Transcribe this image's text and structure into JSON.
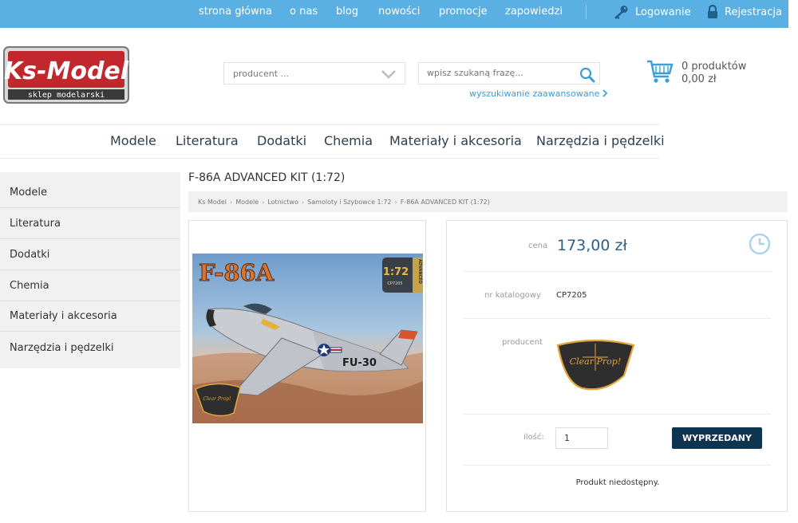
{
  "top_nav": {
    "items": [
      "strona główna",
      "o nas",
      "blog",
      "nowości",
      "promocje",
      "zapowiedzi"
    ],
    "login": "Logowanie",
    "register": "Rejestracja"
  },
  "logo": {
    "name": "Ks-Model",
    "tagline": "sklep modelarski"
  },
  "search": {
    "producer_placeholder": "producent ...",
    "query_placeholder": "wpisz szukaną frazę...",
    "advanced_link": "wyszukiwanie zaawansowane"
  },
  "cart": {
    "count": "0 produktów",
    "total": "0,00 zł"
  },
  "main_nav": [
    "Modele",
    "Literatura",
    "Dodatki",
    "Chemia",
    "Materiały i akcesoria",
    "Narzędzia i pędzelki"
  ],
  "sidebar": [
    "Modele",
    "Literatura",
    "Dodatki",
    "Chemia",
    "Materiały i akcesoria",
    "Narzędzia i pędzelki"
  ],
  "product": {
    "title": "F-86A ADVANCED KIT (1:72)",
    "breadcrumb": [
      "Ks Model",
      "Modele",
      "Lotnictwo",
      "Samoloty i Szybowce 1:72",
      "F-86A ADVANCED KIT (1:72)"
    ],
    "box_art": {
      "name": "F-86A",
      "scale": "1:72",
      "catalog": "CP7205",
      "tail_code": "FU-30",
      "series": "ADVANCED",
      "maker_logo": "Clear Prop!"
    },
    "price_label": "cena",
    "price": "173,00 zł",
    "catalog_label": "nr katalogowy",
    "catalog_number": "CP7205",
    "producer_label": "producent",
    "producer_logo_text": "Clear Prop!",
    "quantity_label": "ilość:",
    "quantity": "1",
    "soldout_button": "WYPRZEDANY",
    "availability": "Produkt niedostępny."
  },
  "colors": {
    "top_bar": "#5ab0e2",
    "link": "#3b9ed6",
    "price": "#2d5f87",
    "button": "#0f3450",
    "logo_red": "#c1272d"
  }
}
